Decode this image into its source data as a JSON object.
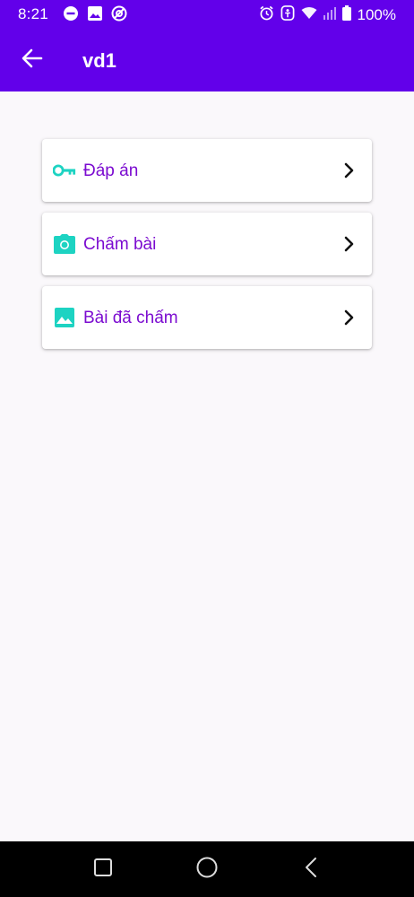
{
  "status_bar": {
    "time": "8:21",
    "battery_percent": "100%",
    "icons_left": [
      "do-not-disturb-icon",
      "image-icon",
      "app-notification-icon"
    ],
    "icons_right": [
      "alarm-icon",
      "accessibility-icon",
      "wifi-icon",
      "signal-icon",
      "battery-icon"
    ]
  },
  "app_bar": {
    "title": "vd1",
    "back_icon": "arrow-left-icon",
    "color": "#6200ea"
  },
  "menu": {
    "items": [
      {
        "label": "Đáp án",
        "icon": "key-icon"
      },
      {
        "label": "Chấm bài",
        "icon": "camera-icon"
      },
      {
        "label": "Bài đã chấm",
        "icon": "image-icon"
      }
    ],
    "icon_color": "#1dd3c2",
    "label_color": "#7b0bd0"
  },
  "nav_bar": {
    "buttons": [
      "recents-square-icon",
      "home-circle-icon",
      "back-chevron-icon"
    ]
  }
}
